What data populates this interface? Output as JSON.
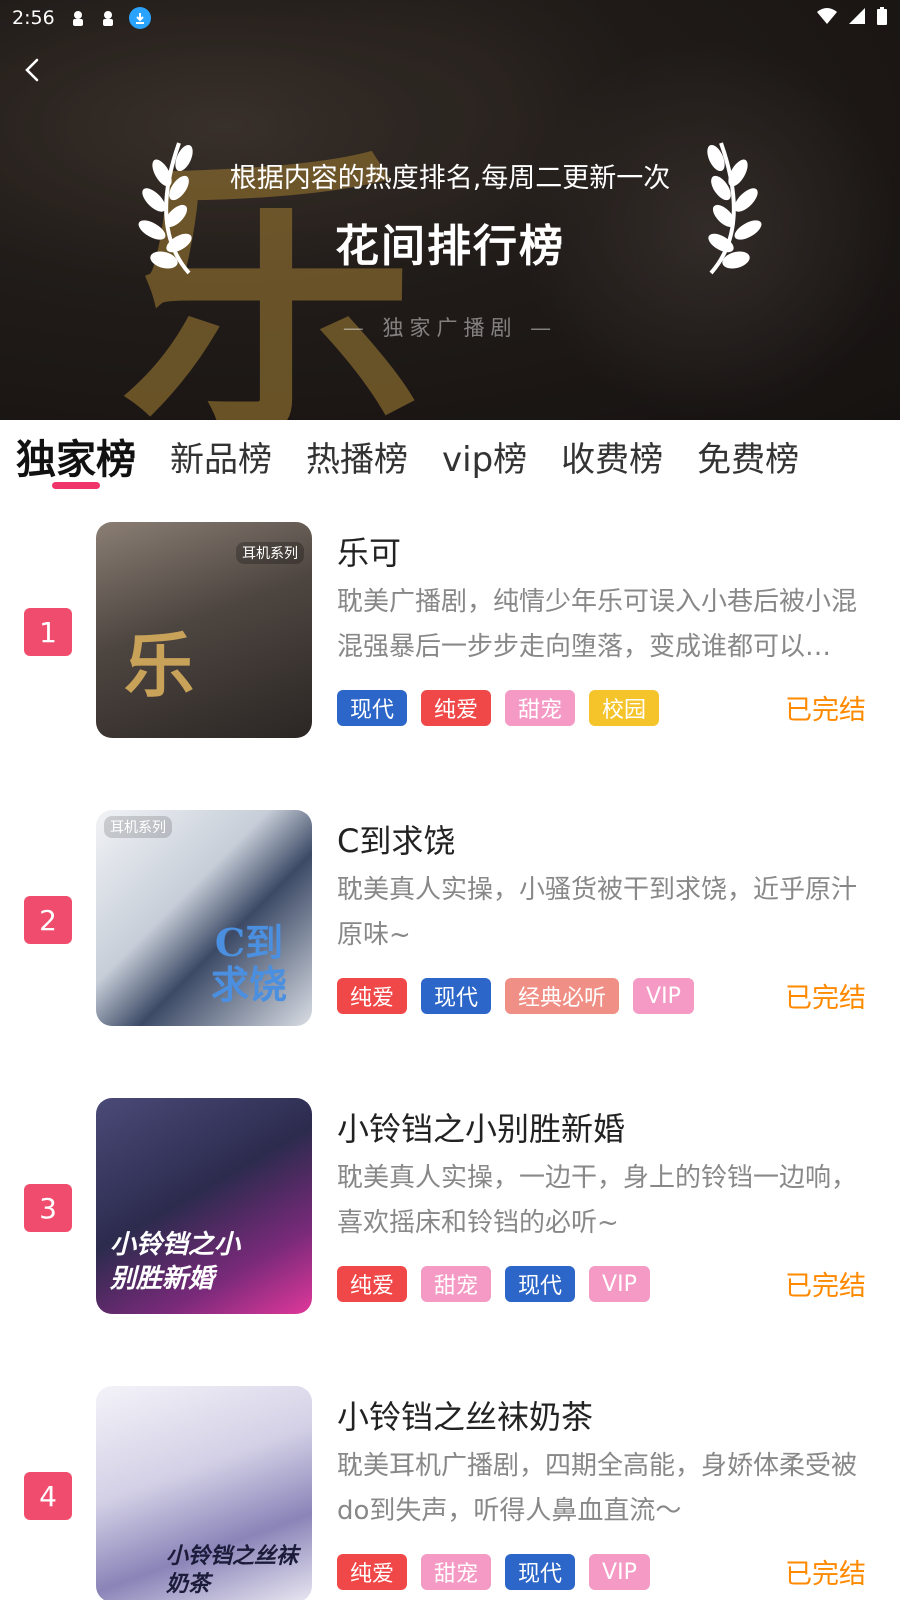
{
  "status_bar": {
    "time": "2:56"
  },
  "header": {
    "subtitle": "根据内容的热度排名,每周二更新一次",
    "title": "花间排行榜",
    "tagline": "— 独家广播剧 —",
    "background_char": "乐"
  },
  "tabs": [
    {
      "label": "独家榜",
      "active": true
    },
    {
      "label": "新品榜",
      "active": false
    },
    {
      "label": "热播榜",
      "active": false
    },
    {
      "label": "vip榜",
      "active": false
    },
    {
      "label": "收费榜",
      "active": false
    },
    {
      "label": "免费榜",
      "active": false
    }
  ],
  "items": [
    {
      "rank": "1",
      "title": "乐可",
      "desc": "耽美广播剧，纯情少年乐可误入小巷后被小混混强暴后一步步走向堕落，变成谁都可以的玩物",
      "tags": [
        {
          "label": "现代",
          "color": "#2b66c8"
        },
        {
          "label": "纯爱",
          "color": "#f04848"
        },
        {
          "label": "甜宠",
          "color": "#f59ac4"
        },
        {
          "label": "校园",
          "color": "#f5c32a"
        }
      ],
      "status": "已完结",
      "cover_series": "耳机系列",
      "cover_char": "乐",
      "cover_colors": [
        "#3a3533",
        "#7b6f66"
      ]
    },
    {
      "rank": "2",
      "title": "C到求饶",
      "desc": "耽美真人实操，小骚货被干到求饶，近乎原汁原味~",
      "tags": [
        {
          "label": "纯爱",
          "color": "#f04848"
        },
        {
          "label": "现代",
          "color": "#2b66c8"
        },
        {
          "label": "经典必听",
          "color": "#ef8f86"
        },
        {
          "label": "VIP",
          "color": "#f59ac4"
        }
      ],
      "status": "已完结",
      "cover_series": "耳机系列",
      "cover_char": "C到求饶",
      "cover_colors": [
        "#dfe6ee",
        "#a9b4c4"
      ]
    },
    {
      "rank": "3",
      "title": "小铃铛之小别胜新婚",
      "desc": "耽美真人实操，一边干，身上的铃铛一边响，喜欢摇床和铃铛的必听~",
      "tags": [
        {
          "label": "纯爱",
          "color": "#f04848"
        },
        {
          "label": "甜宠",
          "color": "#f59ac4"
        },
        {
          "label": "现代",
          "color": "#2b66c8"
        },
        {
          "label": "VIP",
          "color": "#f59ac4"
        }
      ],
      "status": "已完结",
      "cover_series": "",
      "cover_char": "小铃铛之小别胜新婚",
      "cover_colors": [
        "#2f2a55",
        "#c02c8a"
      ]
    },
    {
      "rank": "4",
      "title": "小铃铛之丝袜奶茶",
      "desc": "耽美耳机广播剧，四期全高能，身娇体柔受被do到失声，听得人鼻血直流～",
      "tags": [
        {
          "label": "纯爱",
          "color": "#f04848"
        },
        {
          "label": "甜宠",
          "color": "#f59ac4"
        },
        {
          "label": "现代",
          "color": "#2b66c8"
        },
        {
          "label": "VIP",
          "color": "#f59ac4"
        }
      ],
      "status": "已完结",
      "cover_series": "",
      "cover_char": "小铃铛之丝袜奶茶",
      "cover_colors": [
        "#e7e4f0",
        "#9d97c2"
      ]
    }
  ]
}
